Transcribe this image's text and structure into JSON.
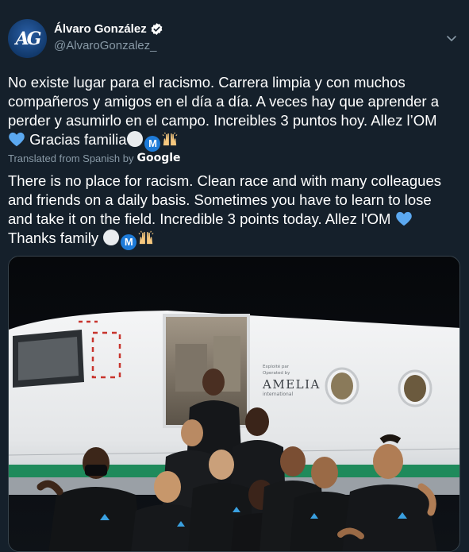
{
  "tweet": {
    "author": {
      "display_name": "Álvaro González",
      "handle": "@AlvaroGonzalez_",
      "avatar_initials": "AG",
      "verified": true
    },
    "original_lines": [
      "No existe lugar para el racismo. Carrera limpia y con muchos",
      "compañeros y amigos en el día a día. A veces hay que aprender a",
      "perder y asumirlo en el campo. Increibles 3 puntos hoy. Allez l’OM"
    ],
    "original_last_line": "Gracias familia",
    "translated_from": "Translated from Spanish by",
    "translator": "Google",
    "translated_lines": [
      "There is no place for racism. Clean race and with many colleagues",
      "and friends on a daily basis. Sometimes you have to learn to lose",
      "and take it on the field. Incredible 3 points today. Allez l'OM"
    ],
    "translated_last_line": "Thanks family",
    "media": {
      "aircraft_brand": "AMELIA",
      "aircraft_brand_sub": "international",
      "aircraft_small_text": "Exploité par\nOperated by"
    }
  },
  "colors": {
    "background": "#15202b",
    "secondary_text": "#8899a6",
    "verified_blue": "#1da1f2",
    "heart_blue": "#5ba8f0"
  }
}
